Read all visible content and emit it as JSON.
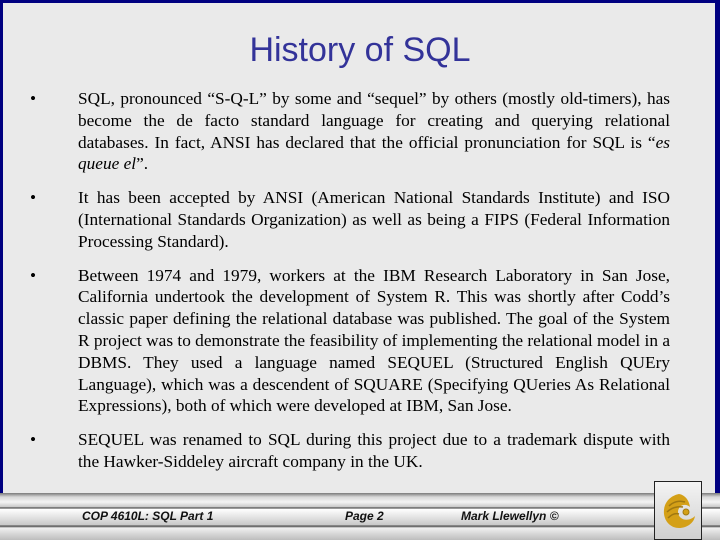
{
  "slide": {
    "title": "History of SQL",
    "bullet_char": "•",
    "bullets": [
      {
        "text_before": "SQL, pronounced “S-Q-L” by some and “sequel” by others (mostly old-timers), has become the de facto standard language for creating and querying relational databases.  In fact, ANSI has declared that the official pronunciation for SQL is “",
        "text_italic": "es queue el",
        "text_after": "”."
      },
      {
        "text": "It has been accepted by ANSI (American National Standards Institute) and ISO (International Standards Organization) as well as being a FIPS (Federal Information Processing Standard)."
      },
      {
        "text": "Between 1974 and 1979, workers at the IBM Research Laboratory in San Jose, California undertook the development of System R.  This was shortly after Codd’s classic paper defining the relational database was published.  The goal of the System R project was to demonstrate the feasibility of implementing the relational model in a DBMS.  They used a language named SEQUEL (Structured English QUEry Language), which was a descendent of SQUARE (Specifying QUeries As Relational Expressions), both of which were developed at IBM, San Jose."
      },
      {
        "text": "SEQUEL was renamed to SQL during this project due to a trademark dispute with the Hawker-Siddeley aircraft company in the UK."
      }
    ]
  },
  "footer": {
    "course": "COP 4610L: SQL Part 1",
    "page": "Page 2",
    "author": "Mark Llewellyn ©",
    "logo_icon": "pegasus-logo-icon"
  },
  "colors": {
    "border": "#000080",
    "background": "#eaeaea",
    "title": "#333399",
    "logo_gold": "#d4a017"
  }
}
